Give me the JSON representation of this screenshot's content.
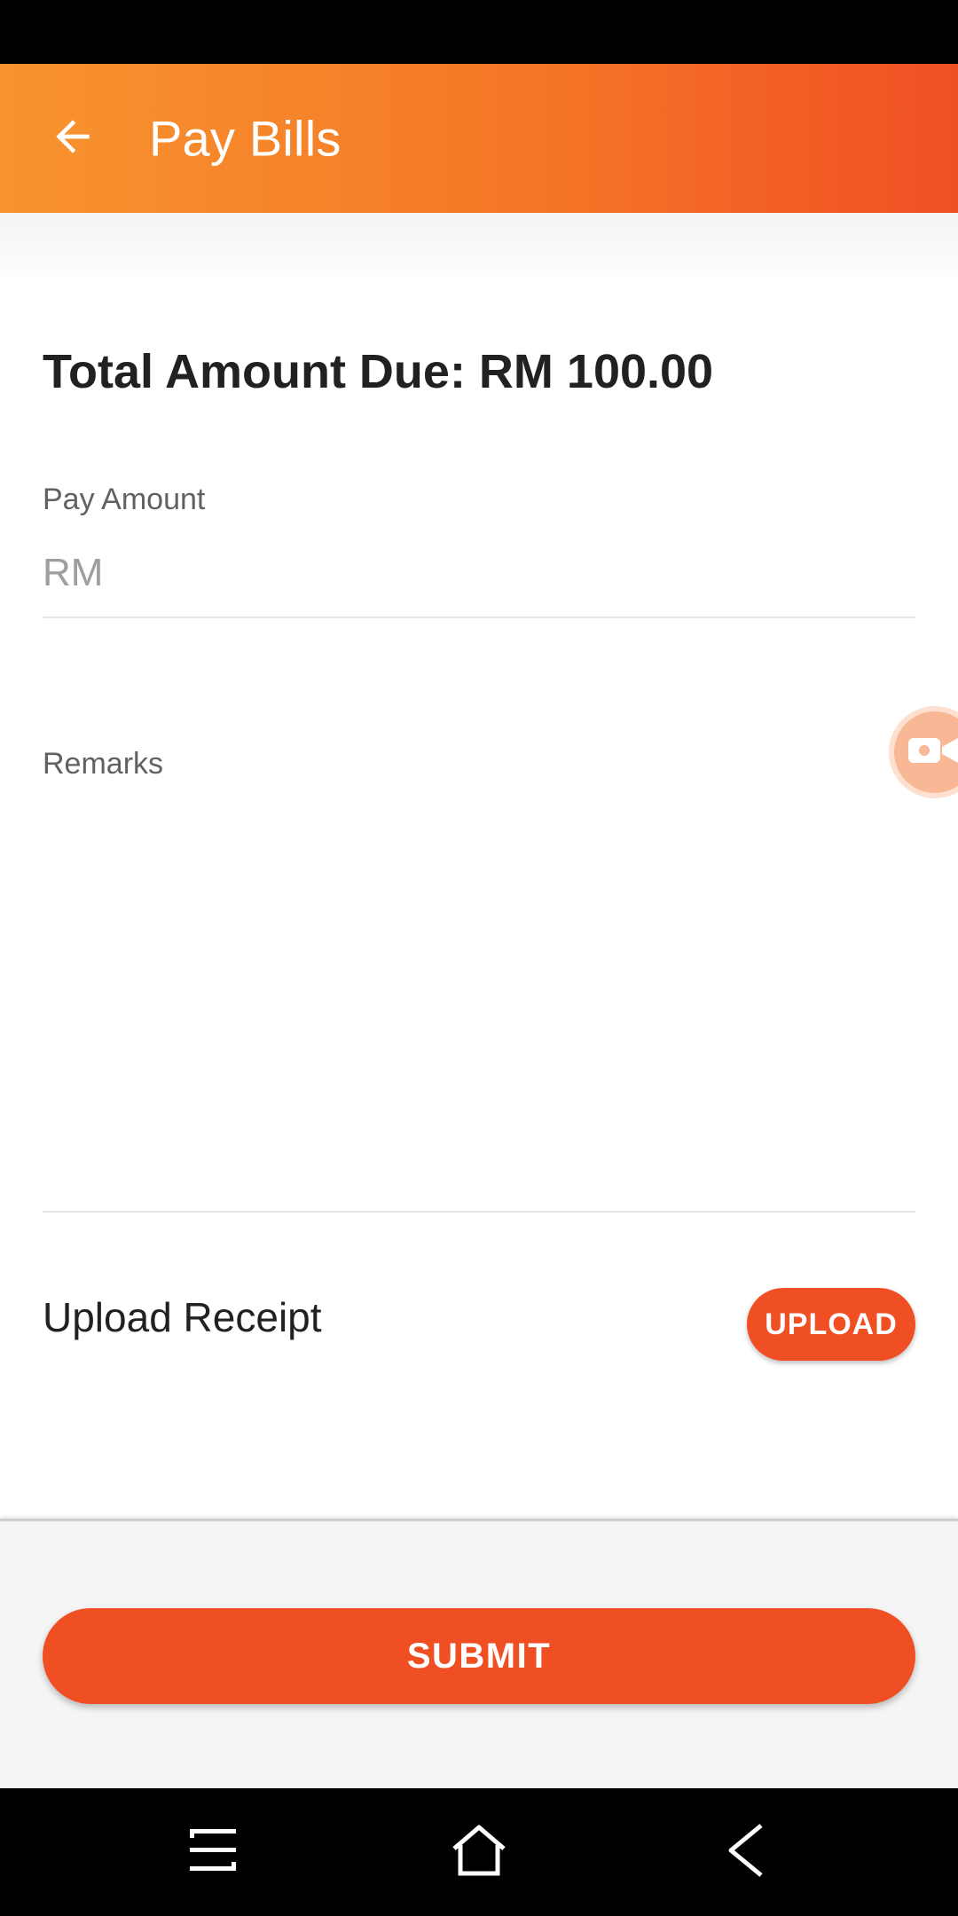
{
  "app_bar": {
    "title": "Pay Bills",
    "back_icon": "arrow-back-icon"
  },
  "summary": {
    "total_amount_due": "Total Amount Due: RM 100.00"
  },
  "form": {
    "pay_amount_label": "Pay Amount",
    "pay_amount_placeholder": "RM",
    "pay_amount_value": "",
    "remarks_label": "Remarks",
    "remarks_value": "",
    "upload_receipt_label": "Upload Receipt",
    "upload_button_label": "UPLOAD"
  },
  "floating_button": {
    "icon": "video-camera-icon"
  },
  "footer": {
    "submit_label": "SUBMIT"
  },
  "system_nav": {
    "recent_icon": "recent-apps-icon",
    "home_icon": "home-icon",
    "back_icon": "nav-back-icon"
  },
  "colors": {
    "accent": "#f04e23",
    "header_start": "#f7942e",
    "header_end": "#f04f24"
  }
}
